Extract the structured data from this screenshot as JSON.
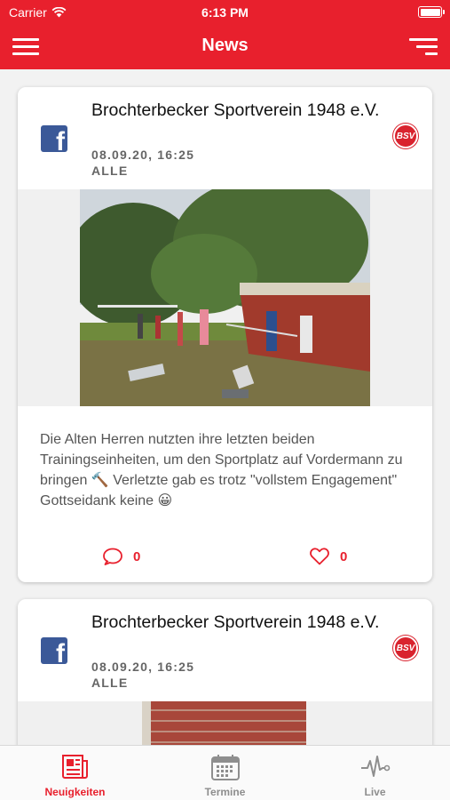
{
  "status_bar": {
    "carrier": "Carrier",
    "time": "6:13 PM"
  },
  "nav": {
    "title": "News",
    "menu_icon": "hamburger-menu-icon",
    "filter_icon": "filter-icon"
  },
  "posts": [
    {
      "source_icon": "facebook-icon",
      "author": "Brochterbecker Sportverein 1948 e.V.",
      "date": "08.09.20, 16:25",
      "audience": "ALLE",
      "club_logo_text": "BSV",
      "text": "Die Alten Herren nutzten ihre letzten beiden Trainingseinheiten, um den Sportplatz auf Vordermann zu bringen 🔨 Verletzte gab es trotz \"vollstem Engagement\" Gottseidank keine 😀",
      "comments": "0",
      "likes": "0"
    },
    {
      "source_icon": "facebook-icon",
      "author": "Brochterbecker Sportverein 1948 e.V.",
      "date": "08.09.20, 16:25",
      "audience": "ALLE",
      "club_logo_text": "BSV"
    }
  ],
  "tabs": [
    {
      "label": "Neuigkeiten",
      "icon": "newspaper-icon",
      "active": true
    },
    {
      "label": "Termine",
      "icon": "calendar-icon",
      "active": false
    },
    {
      "label": "Live",
      "icon": "pulse-icon",
      "active": false
    }
  ],
  "colors": {
    "accent": "#e8202d",
    "facebook": "#3b5998",
    "inactive": "#8e8e8e"
  }
}
